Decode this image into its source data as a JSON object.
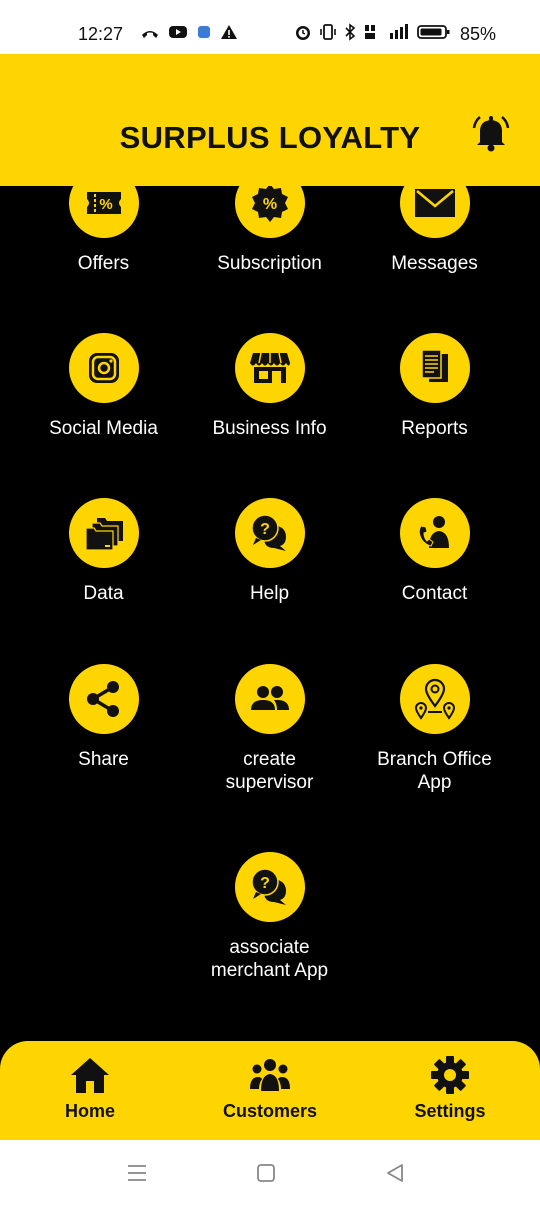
{
  "status_bar": {
    "time": "12:27",
    "battery": "85%"
  },
  "header": {
    "title": "SURPLUS LOYALTY"
  },
  "tiles": [
    {
      "label": "Offers",
      "icon": "coupon-icon"
    },
    {
      "label": "Subscription",
      "icon": "discount-badge-icon"
    },
    {
      "label": "Messages",
      "icon": "envelope-icon"
    },
    {
      "label": "Social Media",
      "icon": "instagram-icon"
    },
    {
      "label": "Business Info",
      "icon": "storefront-icon"
    },
    {
      "label": "Reports",
      "icon": "report-documents-icon"
    },
    {
      "label": "Data",
      "icon": "folders-icon"
    },
    {
      "label": "Help",
      "icon": "help-chat-icon"
    },
    {
      "label": "Contact",
      "icon": "phone-person-icon"
    },
    {
      "label": "Share",
      "icon": "share-icon"
    },
    {
      "label": "create\nsupervisor",
      "icon": "people-icon"
    },
    {
      "label": "Branch Office\nApp",
      "icon": "location-pins-icon"
    },
    {
      "label": "associate\nmerchant App",
      "icon": "help-chat-icon"
    }
  ],
  "bottom_nav": [
    {
      "label": "Home",
      "icon": "home-icon"
    },
    {
      "label": "Customers",
      "icon": "group-icon"
    },
    {
      "label": "Settings",
      "icon": "gear-icon"
    }
  ],
  "colors": {
    "accent": "#FFD500",
    "background": "#000000",
    "text_on_dark": "#FFFFFF"
  }
}
